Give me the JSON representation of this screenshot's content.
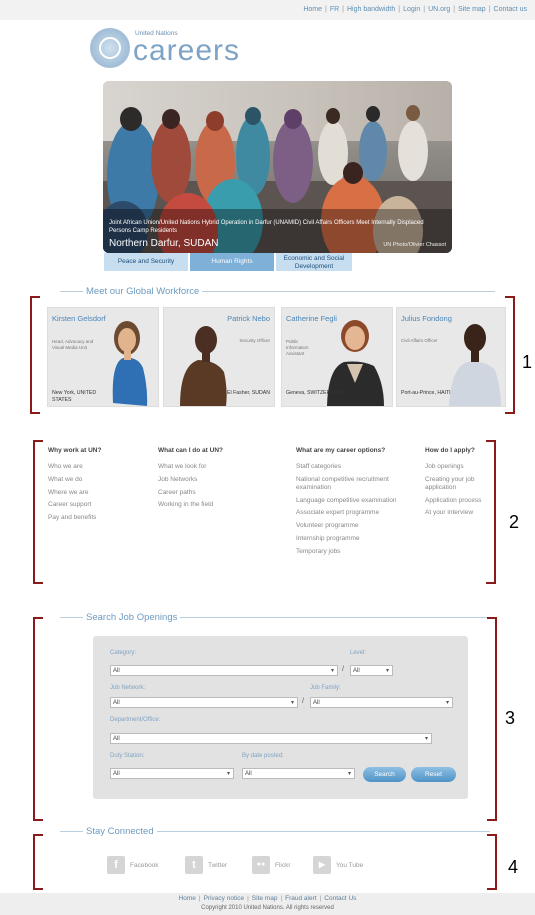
{
  "topnav": [
    "Home",
    "FR",
    "High bandwidth",
    "Login",
    "UN.org",
    "Site map",
    "Contact us"
  ],
  "logo": {
    "small": "United Nations",
    "big": "careers"
  },
  "hero": {
    "caption": "Joint African Union/United Nations Hybrid Operation in Darfur (UNAMID) Civil Affairs Officers Meet Internally Displaced Persons Camp Residents",
    "location": "Northern Darfur, SUDAN",
    "credit": "UN Photo/Olivier Chassot"
  },
  "tabs": [
    "Peace and Security",
    "Human Rights",
    "Economic and Social Development"
  ],
  "workforce": {
    "title": "Meet our Global Workforce",
    "people": [
      {
        "name": "Kirsten Gelsdorf",
        "title": "Head, Advocacy and Visual Media Unit",
        "location": "New York, UNITED STATES"
      },
      {
        "name": "Patrick Nebo",
        "title": "Security Officer",
        "location": "El Fasher, SUDAN"
      },
      {
        "name": "Catherine Fegli",
        "title": "Public Information Assistant",
        "location": "Geneva, SWITZERLAND"
      },
      {
        "name": "Julius Fondong",
        "title": "Civil Affairs Officer",
        "location": "Port-au-Prince, HAITI"
      }
    ]
  },
  "columns": [
    {
      "heading": "Why work at UN?",
      "items": [
        "Who we are",
        "What we do",
        "Where we are",
        "Career support",
        "Pay and benefits"
      ]
    },
    {
      "heading": "What can I do at UN?",
      "items": [
        "What we look for",
        "Job Networks",
        "Career paths",
        "Working in the field"
      ]
    },
    {
      "heading": "What are my career options?",
      "items": [
        "Staff categories",
        "National competitive recruitment examination",
        "Language competitive examination",
        "Associate expert programme",
        "Volunteer programme",
        "Internship programme",
        "Temporary jobs"
      ]
    },
    {
      "heading": "How do I apply?",
      "items": [
        "Job openings",
        "Creating your job application",
        "Application process",
        "At your interview"
      ]
    }
  ],
  "search": {
    "title": "Search Job Openings",
    "labels": {
      "category": "Category:",
      "level": "Level:",
      "job_network": "Job Network:",
      "job_family": "Job Family:",
      "department": "Department/Office:",
      "duty_station": "Duty Station:",
      "date_posted": "By date posted:"
    },
    "values": {
      "category": "All",
      "level": "All",
      "job_network": "All",
      "job_family": "All",
      "department": "All",
      "duty_station": "All",
      "date_posted": "All"
    },
    "slash": "/",
    "search_btn": "Search",
    "reset_btn": "Reset"
  },
  "connected": {
    "title": "Stay Connected",
    "items": [
      {
        "icon": "f",
        "label": "Facebook"
      },
      {
        "icon": "t",
        "label": "Twitter"
      },
      {
        "icon": "●●",
        "label": "Flickr"
      },
      {
        "icon": "▶",
        "label": "You Tube"
      }
    ]
  },
  "annotations": [
    "1",
    "2",
    "3",
    "4"
  ],
  "footer": {
    "links": [
      "Home",
      "Privacy notice",
      "Site map",
      "Fraud alert",
      "Contact Us"
    ],
    "copyright": "Copyright 2010 United Nations. All rights reserved"
  }
}
